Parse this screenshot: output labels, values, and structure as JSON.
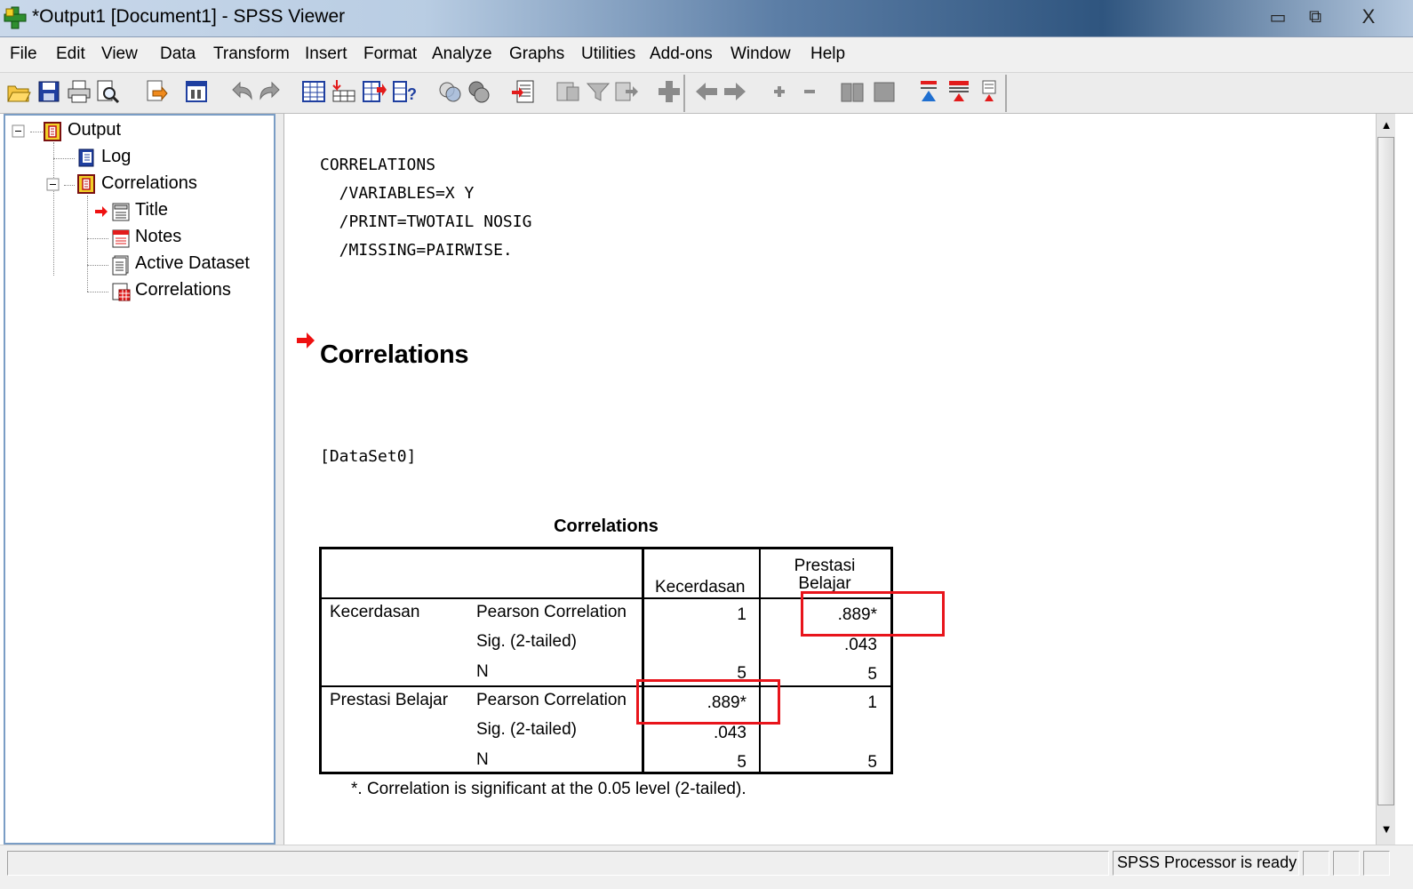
{
  "window": {
    "title": "*Output1 [Document1] - SPSS Viewer",
    "minimize": "▭",
    "restore": "⧉",
    "close": "X"
  },
  "menu": [
    "File",
    "Edit",
    "View",
    "Data",
    "Transform",
    "Insert",
    "Format",
    "Analyze",
    "Graphs",
    "Utilities",
    "Add-ons",
    "Window",
    "Help"
  ],
  "toolbar_icons": [
    "open-icon",
    "save-icon",
    "print-icon",
    "print-preview-icon",
    "export-icon",
    "recall-dialog-icon",
    "undo-icon",
    "redo-icon",
    "goto-data-icon",
    "goto-case-icon",
    "insert-variable-icon",
    "variables-info-icon",
    "use-sets-icon",
    "show-all-variables-icon",
    "designate-window-icon",
    "insert-heading-icon",
    "insert-title-icon",
    "insert-text-icon",
    "select-last-output-icon",
    "promote-icon",
    "demote-icon",
    "expand-icon",
    "collapse-icon",
    "show-icon",
    "hide-icon",
    "pivot-icon",
    "pivot-tray-icon",
    "pivot-layer-icon"
  ],
  "outline": {
    "root": "Output",
    "log": "Log",
    "correlations": "Correlations",
    "children": [
      "Title",
      "Notes",
      "Active Dataset",
      "Correlations"
    ]
  },
  "syntax": [
    "CORRELATIONS",
    "  /VARIABLES=X Y",
    "  /PRINT=TWOTAIL NOSIG",
    "  /MISSING=PAIRWISE."
  ],
  "heading": "Correlations",
  "dataset": "[DataSet0]",
  "table": {
    "title": "Correlations",
    "col_headers": [
      "Kecerdasan",
      "Prestasi Belajar"
    ],
    "rows": [
      {
        "variable": "Kecerdasan",
        "stats": [
          "Pearson Correlation",
          "Sig. (2-tailed)",
          "N"
        ],
        "kecerdasan": [
          "1",
          "",
          "5"
        ],
        "prestasi": [
          ".889*",
          ".043",
          "5"
        ]
      },
      {
        "variable": "Prestasi Belajar",
        "stats": [
          "Pearson Correlation",
          "Sig. (2-tailed)",
          "N"
        ],
        "kecerdasan": [
          ".889*",
          ".043",
          "5"
        ],
        "prestasi": [
          "1",
          "",
          "5"
        ]
      }
    ],
    "footnote": "*. Correlation is significant at the 0.05 level (2-tailed)."
  },
  "status": "SPSS  Processor is ready",
  "colors": {
    "highlight": "#e8141b",
    "selection_arrow": "#ee1111"
  }
}
